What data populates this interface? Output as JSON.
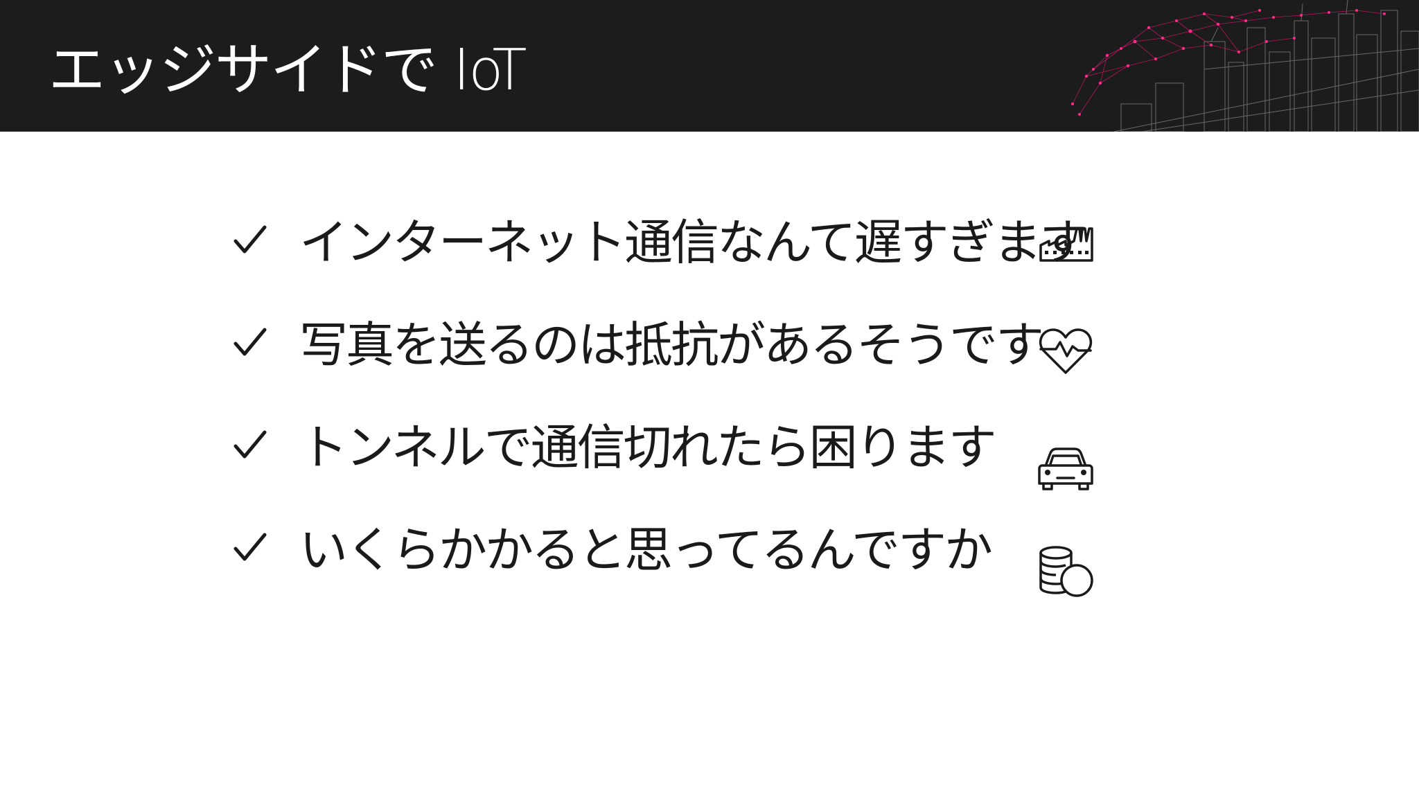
{
  "slide": {
    "title": "エッジサイドで IoT",
    "colors": {
      "header_bg": "#1c1c1c",
      "title_text": "#ffffff",
      "accent_magenta": "#e0136e",
      "body_text": "#1a1a1a"
    }
  },
  "items": [
    {
      "check_icon": "checkmark-icon",
      "text": "インターネット通信なんて遅すぎます",
      "icon": "factory-icon"
    },
    {
      "check_icon": "checkmark-icon",
      "text": "写真を送るのは抵抗があるそうです",
      "icon": "heartbeat-icon"
    },
    {
      "check_icon": "checkmark-icon",
      "text": "トンネルで通信切れたら困ります",
      "icon": "car-icon"
    },
    {
      "check_icon": "checkmark-icon",
      "text": "いくらかかると思ってるんですか",
      "icon": "coins-icon"
    }
  ]
}
